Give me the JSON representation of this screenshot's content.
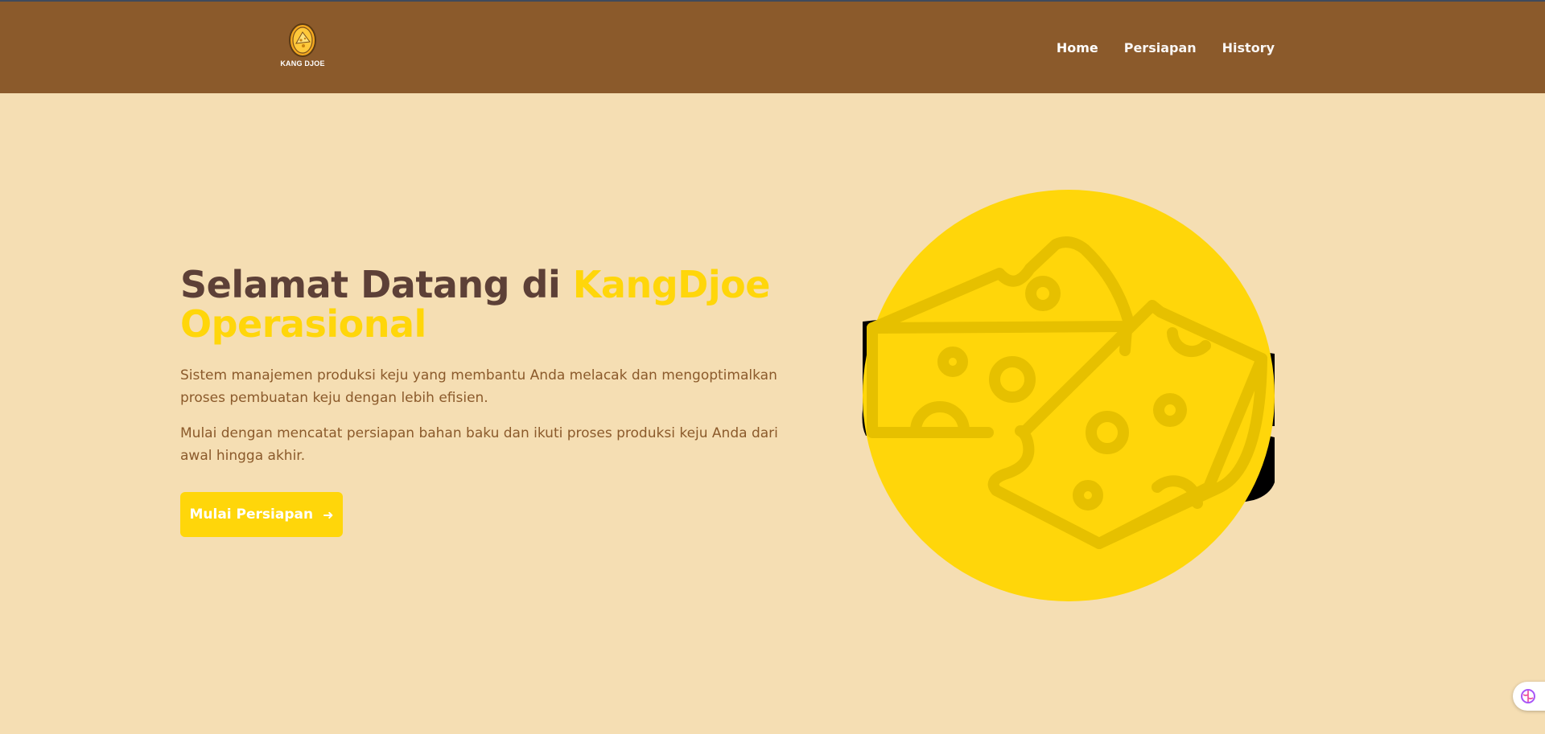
{
  "brand": {
    "logo_text": "KANG DJOE"
  },
  "nav": {
    "items": [
      "Home",
      "Persiapan",
      "History"
    ]
  },
  "hero": {
    "title_part1": "Selamat Datang di ",
    "title_accent": "KangDjoe Operasional",
    "paragraph1": "Sistem manajemen produksi keju yang membantu Anda melacak dan mengoptimalkan proses pembuatan keju dengan lebih efisien.",
    "paragraph2": "Mulai dengan mencatat persiapan bahan baku dan ikuti proses produksi keju Anda dari awal hingga akhir.",
    "cta_label": "Mulai Persiapan",
    "cta_icon": "arrow-right-icon"
  },
  "illustration": {
    "icon": "cheese-icon"
  },
  "colors": {
    "header_bg": "#8b5a2b",
    "page_bg": "#f5deb3",
    "accent": "#ffd60a",
    "title_dark": "#5d4037",
    "body_text": "#8b5a2b"
  }
}
